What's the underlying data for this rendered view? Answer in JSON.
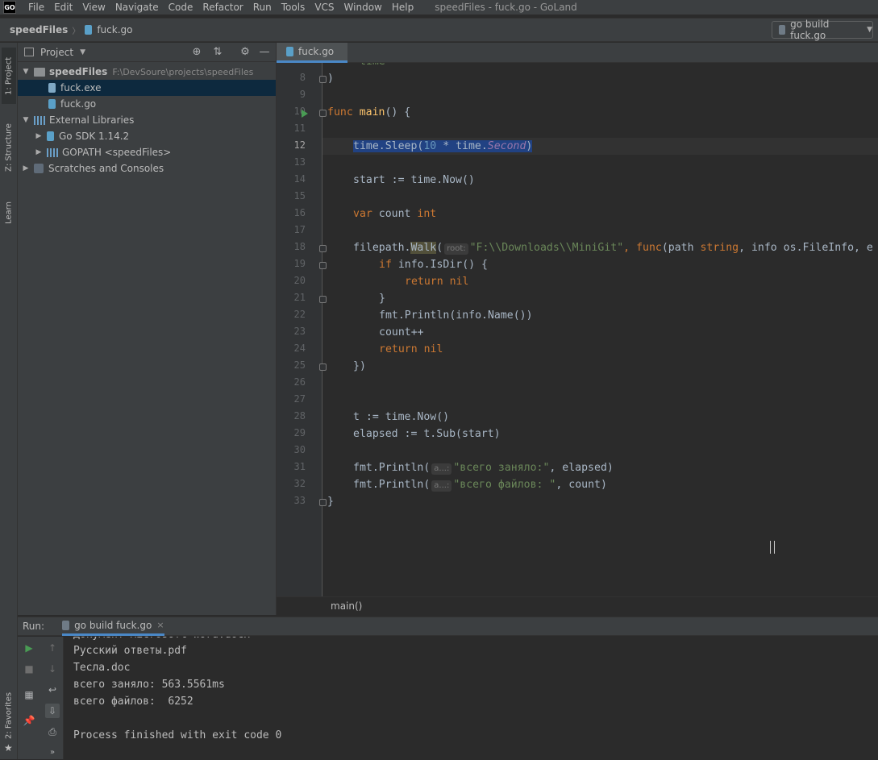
{
  "app": {
    "logo": "GO",
    "window_title": "speedFiles - fuck.go - GoLand"
  },
  "menu": [
    "File",
    "Edit",
    "View",
    "Navigate",
    "Code",
    "Refactor",
    "Run",
    "Tools",
    "VCS",
    "Window",
    "Help"
  ],
  "breadcrumb": {
    "project": "speedFiles",
    "file": "fuck.go"
  },
  "run_config": {
    "label": "go build fuck.go"
  },
  "left_strip": {
    "project_tab": "1: Project",
    "structure_tab": "Z: Structure",
    "learn_tab": "Learn",
    "favorites_tab": "2: Favorites"
  },
  "project_panel": {
    "title": "Project",
    "tree": [
      {
        "label": "speedFiles",
        "path": "F:\\DevSoure\\projects\\speedFiles",
        "type": "folder",
        "expanded": true
      },
      {
        "label": "fuck.exe",
        "type": "exe",
        "selected": true
      },
      {
        "label": "fuck.go",
        "type": "go"
      },
      {
        "label": "External Libraries",
        "type": "lib",
        "expanded": true
      },
      {
        "label": "Go SDK 1.14.2",
        "type": "sdk"
      },
      {
        "label": "GOPATH <speedFiles>",
        "type": "lib"
      },
      {
        "label": "Scratches and Consoles",
        "type": "scratch"
      }
    ]
  },
  "editor": {
    "tab_label": "fuck.go",
    "current_line": 12,
    "line_numbers": [
      "8",
      "9",
      "10",
      "11",
      "12",
      "13",
      "14",
      "15",
      "16",
      "17",
      "18",
      "19",
      "20",
      "21",
      "22",
      "23",
      "24",
      "25",
      "26",
      "27",
      "28",
      "29",
      "30",
      "31",
      "32",
      "33"
    ],
    "top_partial": "\"time\"",
    "code": {
      "l8": ")",
      "l10_kw": "func",
      "l10_fn": "main",
      "l10_rest": "() {",
      "l12_a": "time.",
      "l12_b": "Sleep",
      "l12_c": "(",
      "l12_d": "10",
      "l12_e": " * time.",
      "l12_f": "Second",
      "l12_g": ")",
      "l14": "start := time.Now()",
      "l16_kw": "var",
      "l16_mid": " count ",
      "l16_typ": "int",
      "l18_a": "filepath.",
      "l18_b": "Walk",
      "l18_c": "(",
      "l18_hint": "root:",
      "l18_str": "\"F:\\\\Downloads\\\\MiniGit\"",
      "l18_d": ", ",
      "l18_kw": "func",
      "l18_e": "(path ",
      "l18_t1": "string",
      "l18_f": ", info os.FileInfo, e",
      "l19_kw": "if",
      "l19_rest": " info.IsDir() {",
      "l20": "return nil",
      "l21": "}",
      "l22": "fmt.Println(info.Name())",
      "l23": "count++",
      "l24": "return nil",
      "l25": "})",
      "l28": "t := time.Now()",
      "l29": "elapsed := t.Sub(start)",
      "l31_a": "fmt.Println(",
      "l31_hint": "a...:",
      "l31_str": "\"всего заняло:\"",
      "l31_b": ", elapsed)",
      "l32_a": "fmt.Println(",
      "l32_hint": "a...:",
      "l32_str": "\"всего файлов: \"",
      "l32_b": ", count)",
      "l33": "}"
    },
    "breadcrumb": "main()"
  },
  "run_panel": {
    "label": "Run:",
    "tab": "go build fuck.go",
    "output": [
      "Документ Microsoft Word.docx",
      "Русский ответы.pdf",
      "Тесла.doc",
      "всего заняло: 563.5561ms",
      "всего файлов:  6252",
      "",
      "Process finished with exit code 0"
    ]
  },
  "colors": {
    "keyword": "#cc7832",
    "function": "#ffc66d",
    "string": "#6a8759",
    "number": "#6897bb",
    "selection": "#214283"
  }
}
